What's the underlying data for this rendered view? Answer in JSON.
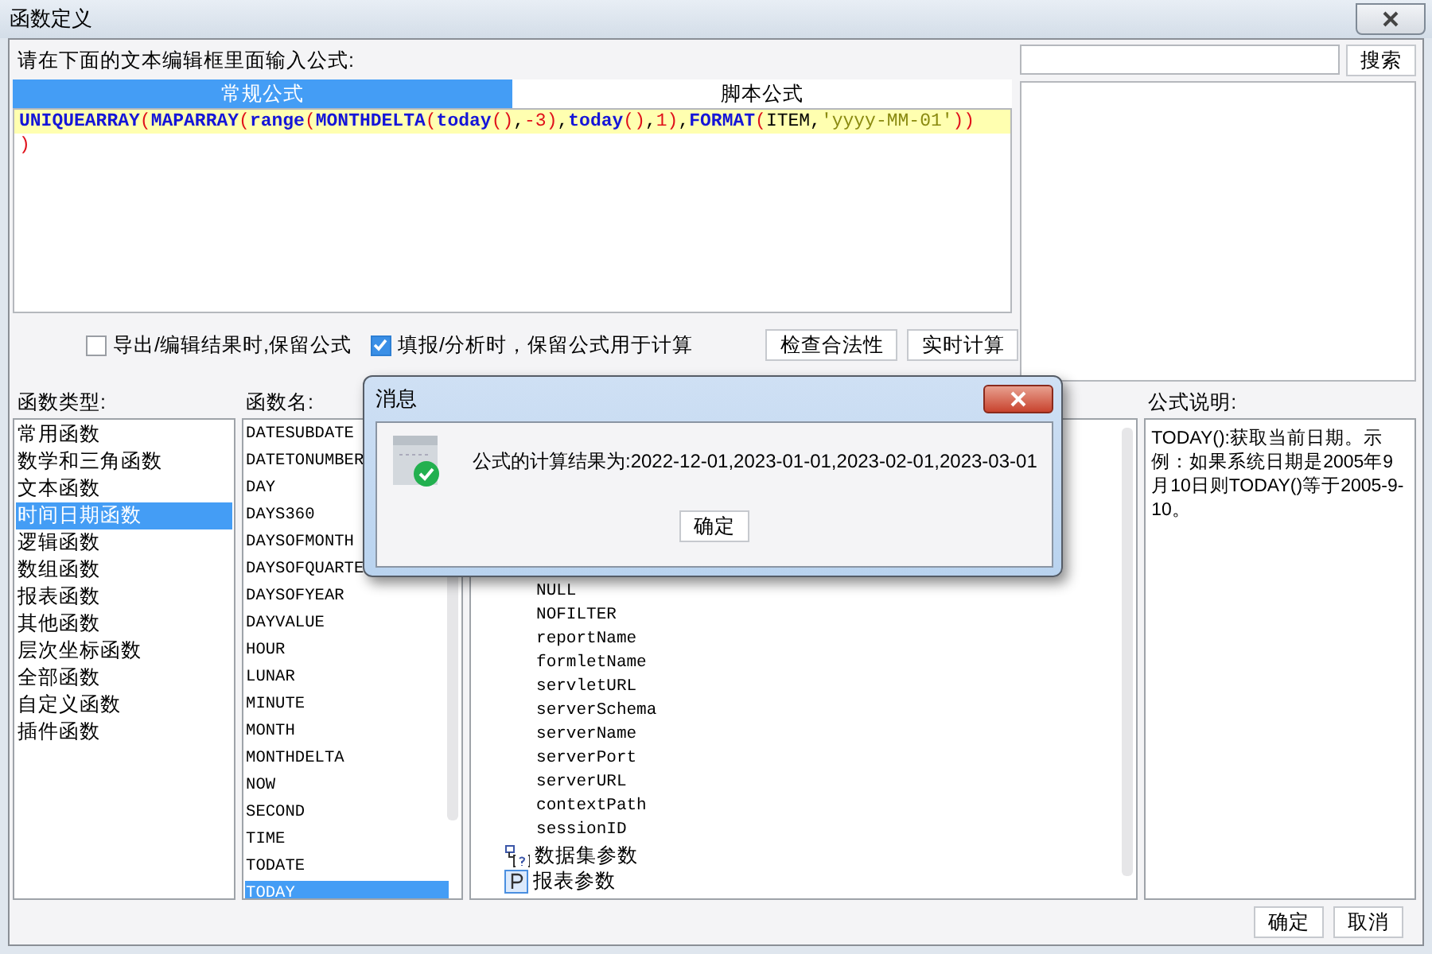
{
  "window": {
    "title": "函数定义"
  },
  "editor": {
    "label": "请在下面的文本编辑框里面输入公式:",
    "tabs": [
      {
        "label": "常规公式",
        "selected": true
      },
      {
        "label": "脚本公式",
        "selected": false
      }
    ],
    "lines": [
      [
        {
          "kind": "function",
          "text": "UNIQUEARRAY"
        },
        {
          "kind": "paren",
          "text": "("
        },
        {
          "kind": "function",
          "text": "MAPARRAY"
        },
        {
          "kind": "paren",
          "text": "("
        },
        {
          "kind": "function",
          "text": "range"
        },
        {
          "kind": "paren",
          "text": "("
        },
        {
          "kind": "function",
          "text": "MONTHDELTA"
        },
        {
          "kind": "paren",
          "text": "("
        },
        {
          "kind": "function",
          "text": "today"
        },
        {
          "kind": "paren",
          "text": "()"
        },
        {
          "kind": "plain",
          "text": ","
        },
        {
          "kind": "number",
          "text": "-3"
        },
        {
          "kind": "paren",
          "text": ")"
        },
        {
          "kind": "plain",
          "text": ","
        },
        {
          "kind": "function",
          "text": "today"
        },
        {
          "kind": "paren",
          "text": "()"
        },
        {
          "kind": "plain",
          "text": ","
        },
        {
          "kind": "number",
          "text": "1"
        },
        {
          "kind": "paren",
          "text": ")"
        },
        {
          "kind": "plain",
          "text": ","
        },
        {
          "kind": "function",
          "text": "FORMAT"
        },
        {
          "kind": "paren",
          "text": "("
        },
        {
          "kind": "plain",
          "text": "ITEM,"
        },
        {
          "kind": "string",
          "text": "'yyyy-MM-01'"
        },
        {
          "kind": "paren",
          "text": "))"
        }
      ],
      [
        {
          "kind": "paren",
          "text": ")"
        }
      ]
    ]
  },
  "search": {
    "button": "搜索"
  },
  "options": [
    {
      "label": "导出/编辑结果时,保留公式",
      "checked": false
    },
    {
      "label": "填报/分析时，保留公式用于计算",
      "checked": true
    }
  ],
  "actions": [
    "检查合法性",
    "实时计算"
  ],
  "function_types": {
    "label": "函数类型:",
    "items": [
      {
        "label": "常用函数",
        "selected": false
      },
      {
        "label": "数学和三角函数",
        "selected": false
      },
      {
        "label": "文本函数",
        "selected": false
      },
      {
        "label": "时间日期函数",
        "selected": true
      },
      {
        "label": "逻辑函数",
        "selected": false
      },
      {
        "label": "数组函数",
        "selected": false
      },
      {
        "label": "报表函数",
        "selected": false
      },
      {
        "label": "其他函数",
        "selected": false
      },
      {
        "label": "层次坐标函数",
        "selected": false
      },
      {
        "label": "全部函数",
        "selected": false
      },
      {
        "label": "自定义函数",
        "selected": false
      },
      {
        "label": "插件函数",
        "selected": false
      }
    ]
  },
  "function_names": {
    "label": "函数名:",
    "items": [
      {
        "label": "DATESUBDATE",
        "selected": false
      },
      {
        "label": "DATETONUMBER",
        "selected": false
      },
      {
        "label": "DAY",
        "selected": false
      },
      {
        "label": "DAYS360",
        "selected": false
      },
      {
        "label": "DAYSOFMONTH",
        "selected": false
      },
      {
        "label": "DAYSOFQUARTE",
        "selected": false
      },
      {
        "label": "DAYSOFYEAR",
        "selected": false
      },
      {
        "label": "DAYVALUE",
        "selected": false
      },
      {
        "label": "HOUR",
        "selected": false
      },
      {
        "label": "LUNAR",
        "selected": false
      },
      {
        "label": "MINUTE",
        "selected": false
      },
      {
        "label": "MONTH",
        "selected": false
      },
      {
        "label": "MONTHDELTA",
        "selected": false
      },
      {
        "label": "NOW",
        "selected": false
      },
      {
        "label": "SECOND",
        "selected": false
      },
      {
        "label": "TIME",
        "selected": false
      },
      {
        "label": "TODATE",
        "selected": false
      },
      {
        "label": "TODAY",
        "selected": true
      }
    ]
  },
  "tree": [
    {
      "children": [
        {
          "label": "NULL"
        },
        {
          "label": "NOFILTER"
        },
        {
          "label": "reportName"
        },
        {
          "label": "formletName"
        },
        {
          "label": "servletURL"
        },
        {
          "label": "serverSchema"
        },
        {
          "label": "serverName"
        },
        {
          "label": "serverPort"
        },
        {
          "label": "serverURL"
        },
        {
          "label": "contextPath"
        },
        {
          "label": "sessionID"
        }
      ]
    },
    {
      "label": "数据集参数",
      "kind": "dataset"
    },
    {
      "label": "报表参数",
      "kind": "param"
    }
  ],
  "description": {
    "label": "公式说明:",
    "text": "TODAY():获取当前日期。示例：如果系统日期是2005年9月10日则TODAY()等于2005-9-10。"
  },
  "buttons": [
    "确定",
    "取消"
  ],
  "message_dialog": {
    "title": "消息",
    "message": "公式的计算结果为:2022-12-01,2023-01-01,2023-02-01,2023-03-01",
    "button": "确定"
  }
}
